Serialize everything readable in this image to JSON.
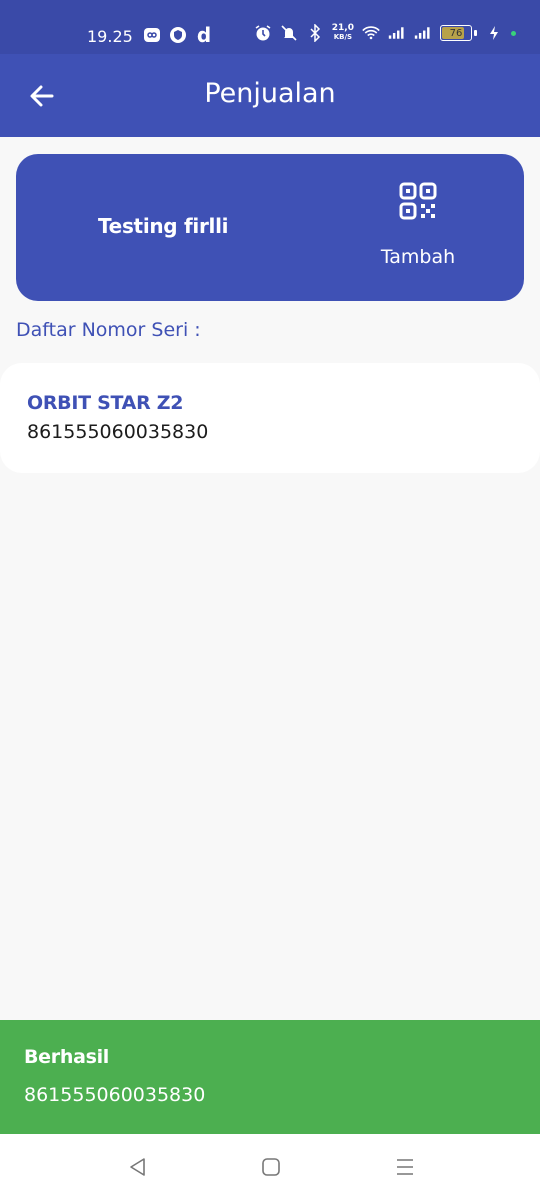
{
  "status_bar": {
    "time": "19.25",
    "network_speed_value": "21,0",
    "network_speed_unit": "KB/S",
    "battery_level": "76"
  },
  "app_bar": {
    "title": "Penjualan",
    "back_icon": "arrow-left-icon"
  },
  "top_card": {
    "customer_name": "Testing firlli",
    "add_label": "Tambah",
    "add_icon": "qr-code-icon"
  },
  "list_label": "Daftar Nomor Seri :",
  "items": [
    {
      "product": "ORBIT STAR Z2",
      "serial": "861555060035830"
    }
  ],
  "snackbar": {
    "title": "Berhasil",
    "message": "861555060035830",
    "color": "#4caf50"
  },
  "colors": {
    "primary": "#3f51b5",
    "status_bar": "#3a4aa8"
  },
  "nav_icons": [
    "back-triangle-icon",
    "home-square-icon",
    "menu-lines-icon"
  ]
}
